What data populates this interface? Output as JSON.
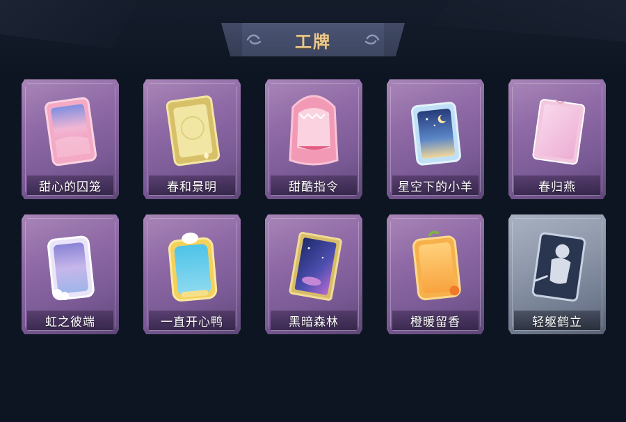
{
  "header": {
    "title": "工牌"
  },
  "badges": [
    {
      "label": "甜心的囚笼",
      "icon": "pink-sky-badge-icon",
      "accent": "#f7a7c4"
    },
    {
      "label": "春和景明",
      "icon": "golden-ornate-badge-icon",
      "accent": "#e8d783"
    },
    {
      "label": "甜酷指令",
      "icon": "pink-shark-badge-icon",
      "accent": "#f29ab5"
    },
    {
      "label": "星空下的小羊",
      "icon": "starry-sheep-badge-icon",
      "accent": "#8ec4ea"
    },
    {
      "label": "春归燕",
      "icon": "pink-swallow-badge-icon",
      "accent": "#f1b6d8"
    },
    {
      "label": "虹之彼端",
      "icon": "rainbow-cloud-badge-icon",
      "accent": "#c7b3ea"
    },
    {
      "label": "一直开心鸭",
      "icon": "happy-duck-badge-icon",
      "accent": "#62c4e6"
    },
    {
      "label": "黑暗森林",
      "icon": "galaxy-forest-badge-icon",
      "accent": "#4b55b8"
    },
    {
      "label": "橙暖留香",
      "icon": "orange-badge-icon",
      "accent": "#f6a33d"
    },
    {
      "label": "轻躯鹤立",
      "icon": "silhouette-placeholder-badge-icon",
      "accent": "#3a4a66"
    }
  ]
}
